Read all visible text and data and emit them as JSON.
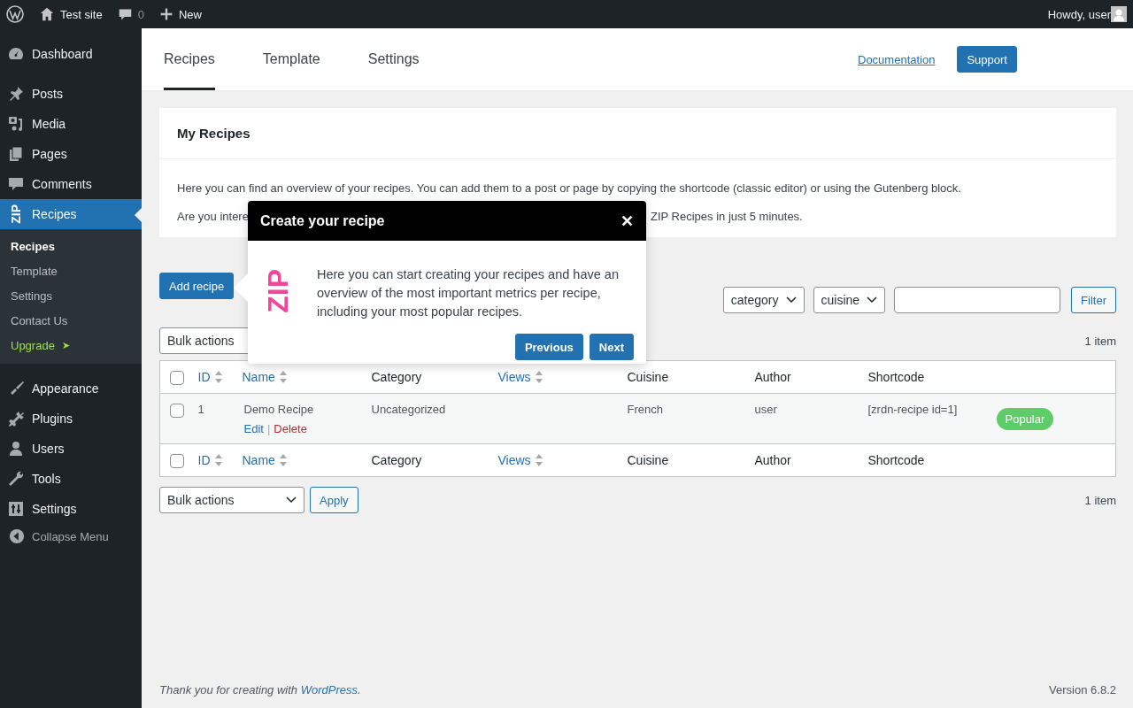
{
  "admin_bar": {
    "site_name": "Test site",
    "comments_count": "0",
    "new_label": "New",
    "greeting": "Howdy, user"
  },
  "sidebar": {
    "groups": [
      {
        "items": [
          {
            "label": "Dashboard",
            "selected": false
          }
        ]
      },
      {
        "items": [
          {
            "label": "Posts",
            "selected": false
          },
          {
            "label": "Media",
            "selected": false
          },
          {
            "label": "Pages",
            "selected": false
          },
          {
            "label": "Comments",
            "selected": false
          },
          {
            "label": "Recipes",
            "selected": true,
            "logo_text": "ZIP",
            "children": [
              {
                "label": "Recipes",
                "kind": "link",
                "selected": true
              },
              {
                "label": "Template",
                "kind": "link",
                "selected": false
              },
              {
                "label": "Settings",
                "kind": "link",
                "selected": false
              },
              {
                "label": "Contact Us",
                "kind": "link",
                "selected": false
              },
              {
                "label": "Upgrade",
                "kind": "upgrade",
                "arrow": "➤",
                "selected": false
              }
            ]
          }
        ]
      },
      {
        "items": [
          {
            "label": "Appearance",
            "selected": false
          },
          {
            "label": "Plugins",
            "selected": false
          },
          {
            "label": "Users",
            "selected": false
          },
          {
            "label": "Tools",
            "selected": false
          },
          {
            "label": "Settings",
            "selected": false
          }
        ]
      }
    ],
    "collapse_label": "Collapse Menu"
  },
  "plugin_tabs": [
    {
      "label": "Recipes",
      "selected": true
    },
    {
      "label": "Template",
      "selected": false
    },
    {
      "label": "Settings",
      "selected": false
    }
  ],
  "documentation_link": "Documentation",
  "support_button": "Support",
  "card": {
    "title": "My Recipes",
    "paragraph": "Here you can find an overview of your recipes. You can add them to a post or page by copying the shortcode (classic editor) or using the Gutenberg block.",
    "paragraph2_start": "Are you intere",
    "paragraph2_end": "ZIP Recipes in just 5 minutes."
  },
  "add_button": "Add recipe",
  "filters": {
    "category": "category",
    "cuisine": "cuisine",
    "button": "Filter"
  },
  "bulk_top": {
    "select": "Bulk actions",
    "count": "1 item"
  },
  "table": {
    "header_checkbox": {
      "checked": false
    },
    "footer_checkbox": {
      "checked": false
    },
    "columns": [
      {
        "label": "ID",
        "sortable": true
      },
      {
        "label": "Name",
        "sortable": true
      },
      {
        "label": "Category",
        "sortable": false
      },
      {
        "label": "Views",
        "sortable": true
      },
      {
        "label": "Cuisine",
        "sortable": false
      },
      {
        "label": "Author",
        "sortable": false
      },
      {
        "label": "Shortcode",
        "sortable": false
      }
    ],
    "footer_columns": [
      {
        "label": "ID",
        "sortable": true
      },
      {
        "label": "Name",
        "sortable": true
      },
      {
        "label": "Category",
        "sortable": false
      },
      {
        "label": "Views",
        "sortable": true
      },
      {
        "label": "Cuisine",
        "sortable": false
      },
      {
        "label": "Author",
        "sortable": false
      },
      {
        "label": "Shortcode",
        "sortable": false
      }
    ],
    "rows": [
      {
        "checked": false,
        "id": "1",
        "name": "Demo Recipe",
        "actions": [
          {
            "label": "Edit",
            "kind": "edit"
          },
          {
            "label": "Delete",
            "kind": "delete"
          }
        ],
        "action_separator": "|",
        "category": "Uncategorized",
        "cuisine": "French",
        "author": "user",
        "shortcode": "[zrdn-recipe id=1]",
        "badge": "Popular"
      }
    ]
  },
  "bulk_bottom": {
    "select": "Bulk actions",
    "apply": "Apply",
    "count": "1 item"
  },
  "popover": {
    "title": "Create your recipe",
    "close": "✕",
    "logo_text": "ZIP",
    "text": "Here you can start creating your recipes and have an overview of the most important metrics per recipe, including your most popular recipes.",
    "buttons": [
      "Previous",
      "Next"
    ]
  },
  "footer": {
    "text_before": "Thank you for creating with ",
    "link": "WordPress",
    "text_after": ".",
    "version": "Version 6.8.2"
  }
}
